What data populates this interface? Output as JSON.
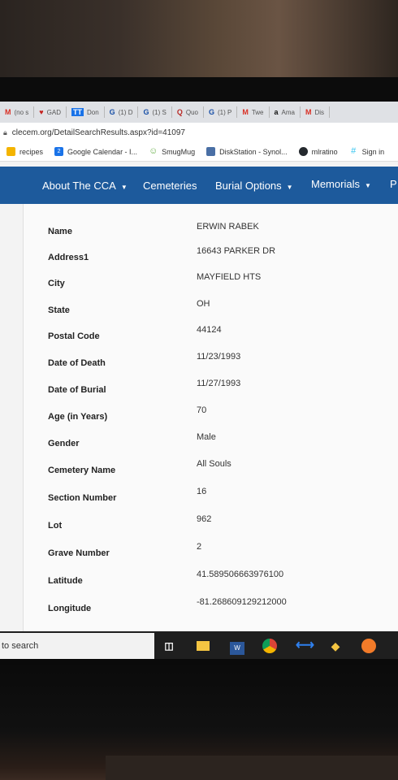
{
  "browser": {
    "tabs": [
      {
        "icon": "M",
        "label": "(no s",
        "color": "#d93025"
      },
      {
        "icon": "♥",
        "label": "GAD",
        "color": "#c5221f"
      },
      {
        "icon": "TT",
        "label": "Don",
        "color": "#1a73e8"
      },
      {
        "icon": "G",
        "label": "(1) D",
        "color": "#174ea6"
      },
      {
        "icon": "G",
        "label": "(1) S",
        "color": "#174ea6"
      },
      {
        "icon": "Q",
        "label": "Quo",
        "color": "#b92b27"
      },
      {
        "icon": "G",
        "label": "(1) P",
        "color": "#174ea6"
      },
      {
        "icon": "M",
        "label": "Twe",
        "color": "#d93025"
      },
      {
        "icon": "a",
        "label": "Ama",
        "color": "#111111"
      },
      {
        "icon": "M",
        "label": "Dis",
        "color": "#d93025"
      }
    ],
    "url": "clecem.org/DetailSearchResults.aspx?id=41097",
    "bookmarks": [
      {
        "label": "recipes",
        "icon_color": "#f4b400"
      },
      {
        "label": "Google Calendar - I...",
        "icon_color": "#1a73e8",
        "icon_text": "2"
      },
      {
        "label": "SmugMug",
        "icon_color": "#6ab04c"
      },
      {
        "label": "DiskStation - Synol...",
        "icon_color": "#4a6fa5"
      },
      {
        "label": "mlratino",
        "icon_color": "#24292e"
      },
      {
        "label": "Sign in",
        "icon_color": "#36c5f0"
      }
    ]
  },
  "site_nav": {
    "items": [
      "About The CCA",
      "Cemeteries",
      "Burial Options",
      "Memorials",
      "P"
    ]
  },
  "record": [
    {
      "label": "Name",
      "value": "ERWIN RABEK"
    },
    {
      "label": "Address1",
      "value": "16643 PARKER DR"
    },
    {
      "label": "City",
      "value": "MAYFIELD HTS"
    },
    {
      "label": "State",
      "value": "OH"
    },
    {
      "label": "Postal Code",
      "value": "44124"
    },
    {
      "label": "Date of Death",
      "value": "11/23/1993"
    },
    {
      "label": "Date of Burial",
      "value": "11/27/1993"
    },
    {
      "label": "Age (in Years)",
      "value": "70"
    },
    {
      "label": "Gender",
      "value": "Male"
    },
    {
      "label": "Cemetery Name",
      "value": "All Souls"
    },
    {
      "label": "Section Number",
      "value": "16"
    },
    {
      "label": "Lot",
      "value": "962"
    },
    {
      "label": "Grave Number",
      "value": "2"
    },
    {
      "label": "Latitude",
      "value": "41.589506663976100"
    },
    {
      "label": "Longitude",
      "value": "-81.268609129212000"
    }
  ],
  "taskbar": {
    "search_placeholder": "to search"
  }
}
